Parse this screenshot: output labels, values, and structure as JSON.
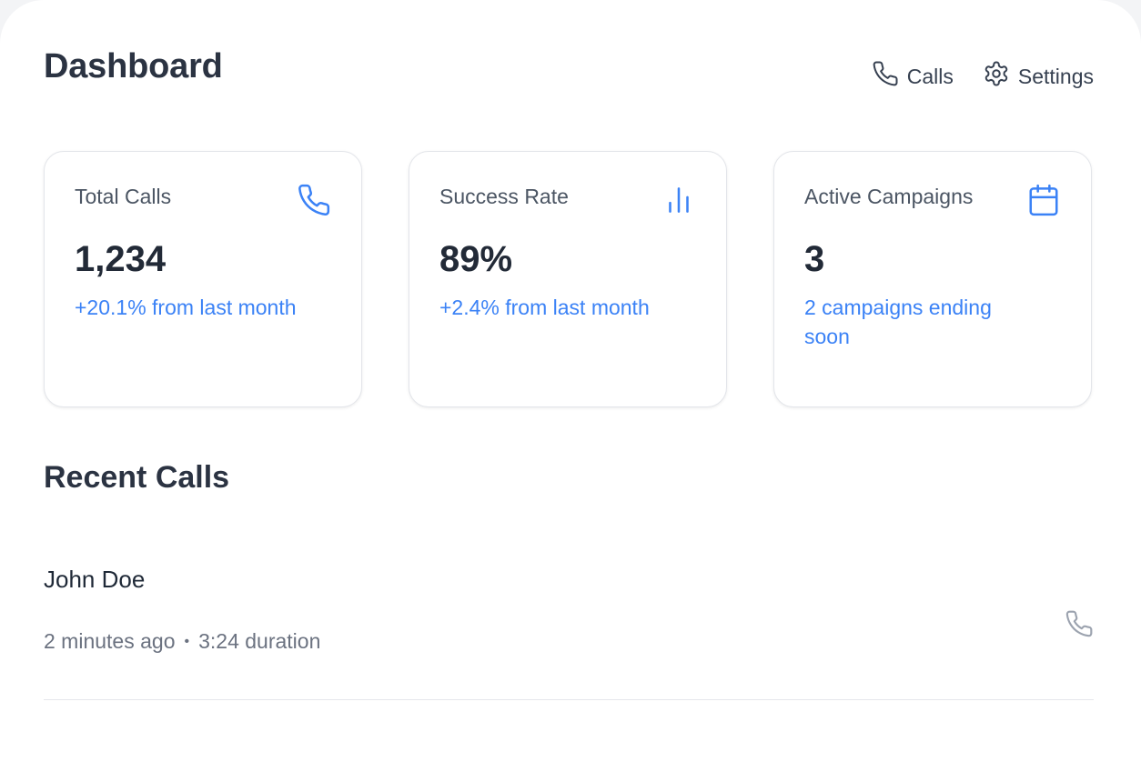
{
  "header": {
    "title": "Dashboard",
    "nav": [
      {
        "label": "Calls",
        "icon": "phone-icon"
      },
      {
        "label": "Settings",
        "icon": "gear-icon"
      }
    ]
  },
  "stats": [
    {
      "label": "Total Calls",
      "value": "1,234",
      "sub": "+20.1% from last month",
      "icon": "phone-icon"
    },
    {
      "label": "Success Rate",
      "value": "89%",
      "sub": "+2.4% from last month",
      "icon": "bar-chart-icon"
    },
    {
      "label": "Active Campaigns",
      "value": "3",
      "sub": "2 campaigns ending soon",
      "icon": "calendar-icon"
    }
  ],
  "recent_calls": {
    "title": "Recent Calls",
    "items": [
      {
        "name": "John Doe",
        "time": "2 minutes ago",
        "duration": "3:24 duration",
        "action_icon": "phone-icon"
      }
    ]
  },
  "colors": {
    "accent": "#3b82f6",
    "text_dark": "#2b3342",
    "text_muted": "#6b7280",
    "border": "#e3e5ea"
  }
}
